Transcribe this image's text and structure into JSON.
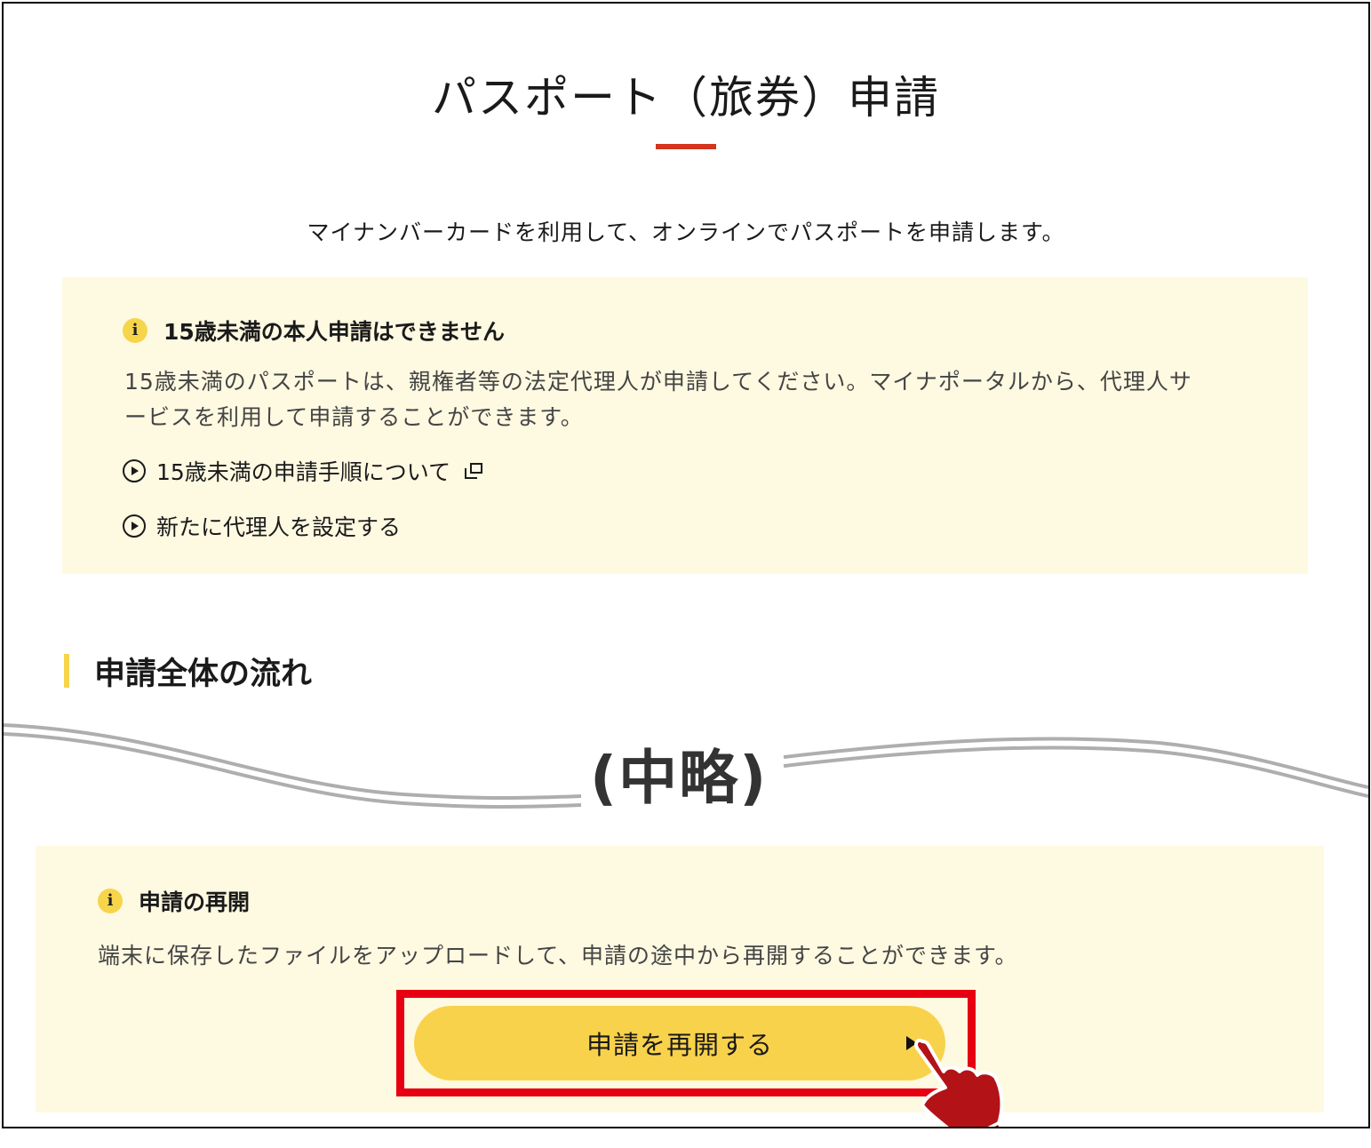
{
  "page": {
    "title": "パスポート（旅券）申請",
    "lead": "マイナンバーカードを利用して、オンラインでパスポートを申請します。"
  },
  "notice_under15": {
    "icon": "info-icon",
    "heading": "15歳未満の本人申請はできません",
    "body_line1": "15歳未満のパスポートは、親権者等の法定代理人が申請してください。マイナポータルから、代理人サ",
    "body_line2": "ービスを利用して申請することができます。",
    "links": [
      {
        "label": "15歳未満の申請手順について",
        "icon": "play-circle-icon",
        "external": true
      },
      {
        "label": "新たに代理人を設定する",
        "icon": "play-circle-icon",
        "external": false
      }
    ]
  },
  "flow_section": {
    "title": "申請全体の流れ"
  },
  "omission": {
    "label": "(中略)"
  },
  "notice_resume": {
    "icon": "info-icon",
    "heading": "申請の再開",
    "body": "端末に保存したファイルをアップロードして、申請の途中から再開することができます。",
    "button_label": "申請を再開する"
  },
  "colors": {
    "accent_red": "#d4351c",
    "notice_bg": "#fef9e1",
    "button_yellow": "#f9d24b",
    "highlight_red": "#e60012"
  }
}
